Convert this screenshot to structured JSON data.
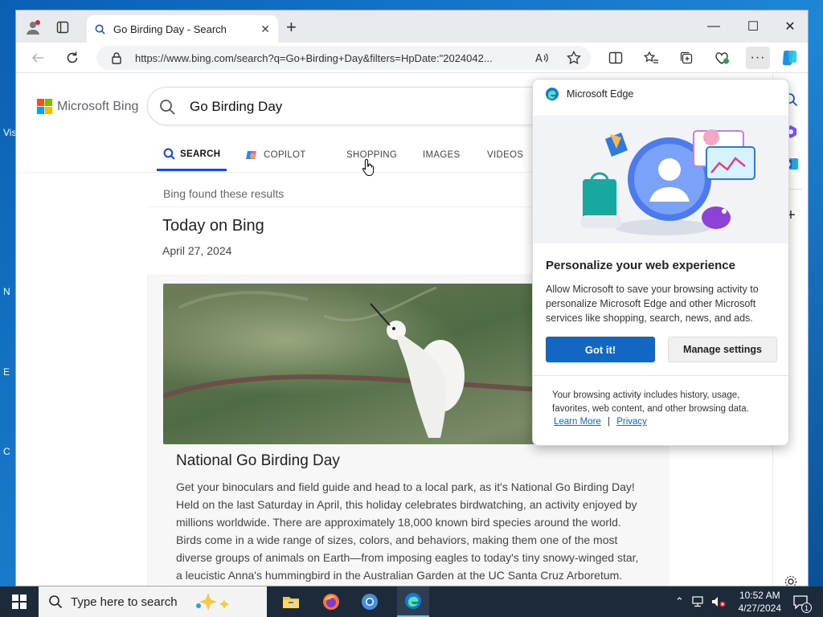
{
  "desktop": {
    "fragments": [
      "Vis",
      "N",
      "E",
      "C"
    ]
  },
  "browser": {
    "tab": {
      "title": "Go Birding Day - Search"
    },
    "address": {
      "url": "https://www.bing.com/search?q=Go+Birding+Day&filters=HpDate:\"2024042..."
    }
  },
  "bing": {
    "logo_text": "Microsoft Bing",
    "search_query": "Go Birding Day",
    "nav": [
      "SEARCH",
      "COPILOT",
      "SHOPPING",
      "IMAGES",
      "VIDEOS"
    ],
    "found_text": "Bing found these results",
    "today": {
      "title": "Today on Bing",
      "date": "April 27, 2024"
    },
    "article": {
      "title": "National Go Birding Day",
      "body": "Get your binoculars and field guide and head to a local park, as it's National Go Birding Day! Held on the last Saturday in April, this holiday celebrates birdwatching, an activity enjoyed by millions worldwide. There are approximately 18,000 known bird species around the world. Birds come in a wide range of sizes, colors, and behaviors, making them one of the most diverse groups of animals on Earth—from imposing eagles to today's tiny snowy-winged star, a leucistic Anna's hummingbird in the Australian Garden at the UC Santa Cruz Arboretum. These hummingbirds are typically vibrant in color, but leucism means some have decreased"
    }
  },
  "popup": {
    "brand": "Microsoft Edge",
    "title": "Personalize your web experience",
    "description": "Allow Microsoft to save your browsing activity to personalize Microsoft Edge and other Microsoft services like shopping, search, news, and ads.",
    "primary_button": "Got it!",
    "secondary_button": "Manage settings",
    "note": "Your browsing activity includes history, usage, favorites, web content, and other browsing data.",
    "link_learn": "Learn More",
    "link_sep": "|",
    "link_privacy": "Privacy"
  },
  "taskbar": {
    "search_placeholder": "Type here to search",
    "time": "10:52 AM",
    "date": "4/27/2024",
    "notification_count": "1"
  },
  "colors": {
    "accent": "#1167c2",
    "bing_blue": "#174ae4"
  }
}
